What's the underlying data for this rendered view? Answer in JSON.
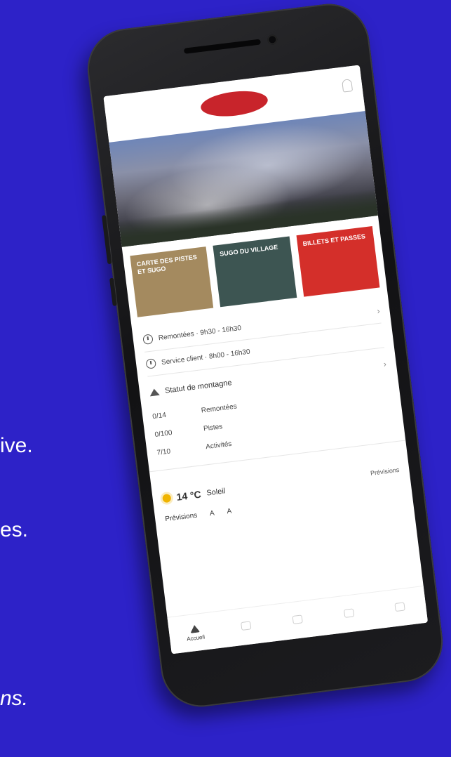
{
  "side_texts": [
    "ive.",
    "es.",
    "ns."
  ],
  "app": {
    "logo_text": "",
    "tiles": [
      {
        "label": "CARTE DES PISTES ET SUGO",
        "color": "#a48a5f"
      },
      {
        "label": "SUGO DU VILLAGE",
        "color": "#3d5552"
      },
      {
        "label": "BILLETS ET PASSES",
        "color": "#d42f2a"
      }
    ],
    "hours": [
      {
        "label": "Remontées · 9h30 - 16h30"
      },
      {
        "label": "Service client · 8h00 - 16h30"
      }
    ],
    "status": {
      "title": "Statut de montagne",
      "rows": [
        {
          "count": "0/14",
          "label": "Remontées"
        },
        {
          "count": "0/100",
          "label": "Pistes"
        },
        {
          "count": "7/10",
          "label": "Activités"
        }
      ]
    },
    "weather": {
      "temp": "14 °C",
      "condition": "Soleil",
      "right": "Prévisions"
    },
    "forecast": {
      "label": "Prévisions",
      "a": "A",
      "b": "A"
    },
    "tabs": [
      {
        "label": "Accueil"
      },
      {
        "label": ""
      },
      {
        "label": ""
      },
      {
        "label": ""
      },
      {
        "label": ""
      }
    ]
  }
}
